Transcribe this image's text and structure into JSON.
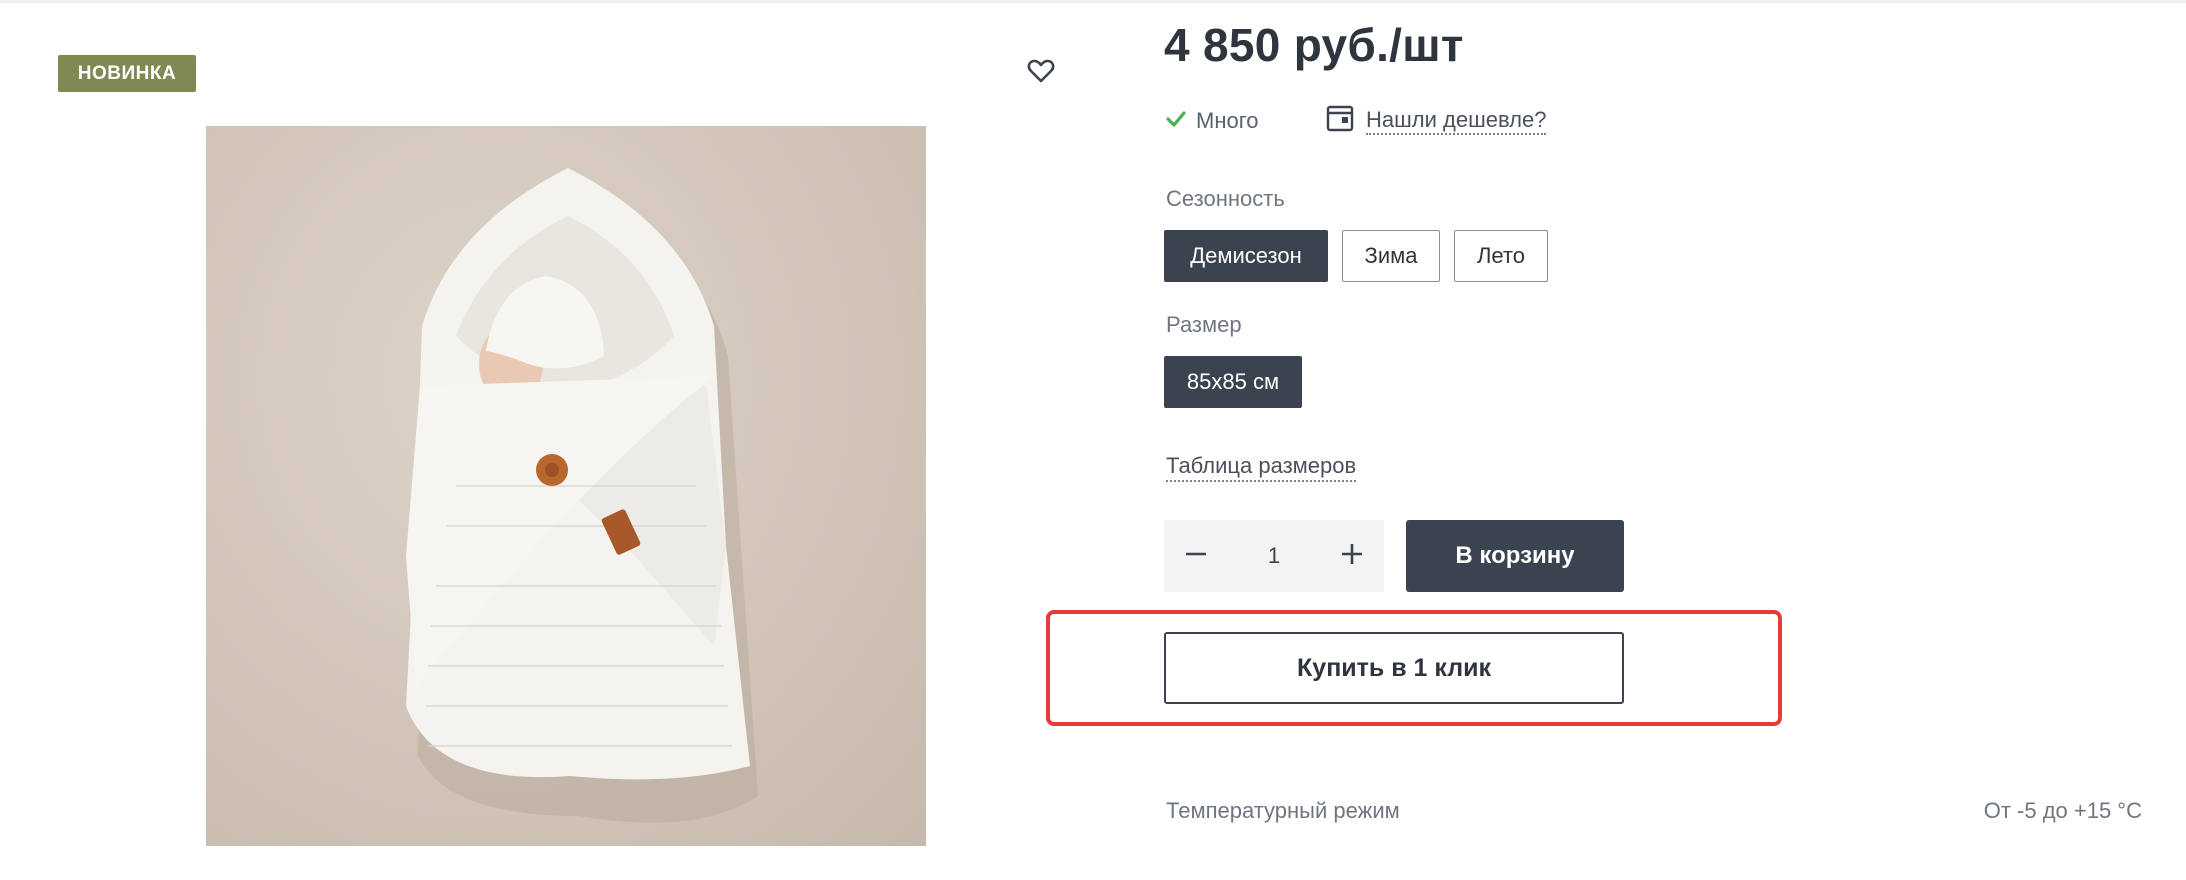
{
  "product": {
    "badge": "НОВИНКА",
    "price": "4 850 руб./шт",
    "stock_status": "Много",
    "cheaper_link": "Нашли дешевле?"
  },
  "options": {
    "season_label": "Сезонность",
    "seasons": [
      {
        "label": "Демисезон",
        "selected": true
      },
      {
        "label": "Зима",
        "selected": false
      },
      {
        "label": "Лето",
        "selected": false
      }
    ],
    "size_label": "Размер",
    "sizes": [
      {
        "label": "85x85 см",
        "selected": true
      }
    ],
    "size_table_link": "Таблица размеров"
  },
  "cart": {
    "quantity": "1",
    "add_to_cart": "В корзину",
    "buy_one_click": "Купить в 1 клик"
  },
  "specs": {
    "temperature_label": "Температурный режим",
    "temperature_value": "От -5 до +15 °С"
  },
  "icons": {
    "favorite": "heart-icon",
    "stock": "checkmark-icon",
    "cheaper": "wallet-icon",
    "minus": "minus-icon",
    "plus": "plus-icon"
  },
  "colors": {
    "badge": "#7e8a52",
    "primary_button": "#3b4350",
    "highlight": "#e53b3b",
    "check": "#4caf50"
  }
}
